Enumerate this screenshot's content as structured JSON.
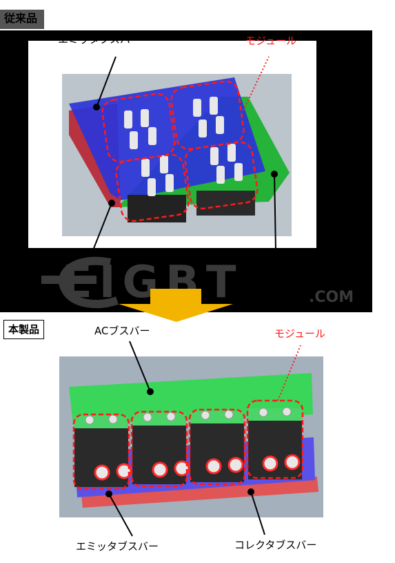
{
  "top_section": {
    "tag": "従来品",
    "labels": {
      "emitter": "エミッタブスバー",
      "module": "モジュール"
    }
  },
  "watermark": {
    "text": "EIGBT",
    "suffix": ".COM"
  },
  "bottom_section": {
    "tag": "本製品",
    "labels": {
      "ac_busbar": "ACブスバー",
      "module": "モジュール",
      "emitter_busbar": "エミッタブスバー",
      "collector_busbar": "コレクタブスバー"
    }
  },
  "colors": {
    "emitter_plate": "#2b2bd6",
    "collector_plate": "#22c53a",
    "ac_plate": "#39d65a",
    "red_plate": "#e24a4a",
    "module_outline": "#ff2020",
    "arrow": "#f3b400"
  }
}
